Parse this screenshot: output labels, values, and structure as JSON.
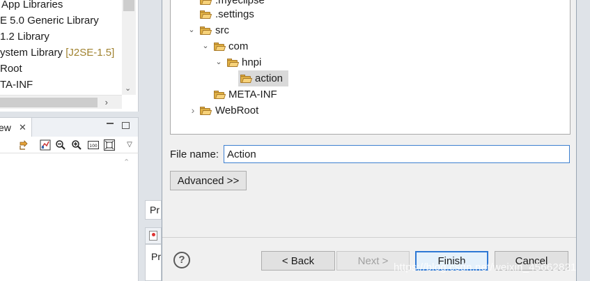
{
  "left_pane": {
    "libraries": [
      {
        "text": "App Libraries",
        "suffix": ""
      },
      {
        "text": "E 5.0 Generic Library",
        "suffix": ""
      },
      {
        "text": "1.2 Library",
        "suffix": ""
      },
      {
        "text": "ystem Library ",
        "suffix": "[J2SE-1.5]"
      },
      {
        "text": "Root",
        "suffix": ""
      },
      {
        "text": "TA-INF",
        "suffix": ""
      }
    ],
    "view_tab_label": "ew",
    "view_tab_close": "✕"
  },
  "background_fragments": {
    "pr_top": "Pr",
    "pr_bottom": "Pr"
  },
  "dialog": {
    "tree": [
      {
        "label": ".myeclipse",
        "level": 1,
        "twisty": ""
      },
      {
        "label": ".settings",
        "level": 1,
        "twisty": ""
      },
      {
        "label": "src",
        "level": 1,
        "twisty": "⌄"
      },
      {
        "label": "com",
        "level": 2,
        "twisty": "⌄"
      },
      {
        "label": "hnpi",
        "level": 3,
        "twisty": "⌄"
      },
      {
        "label": "action",
        "level": 4,
        "twisty": "",
        "selected": true
      },
      {
        "label": "META-INF",
        "level": 2,
        "twisty": ""
      },
      {
        "label": "WebRoot",
        "level": 1,
        "twisty": "›"
      }
    ],
    "file_name_label": "File name:",
    "file_name_value": "Action",
    "advanced_label": "Advanced >>",
    "help_glyph": "?",
    "buttons": {
      "back": "< Back",
      "next": "Next >",
      "finish": "Finish",
      "cancel": "Cancel"
    }
  },
  "watermark": "https://blog.csdn.net/weixin_45662821"
}
